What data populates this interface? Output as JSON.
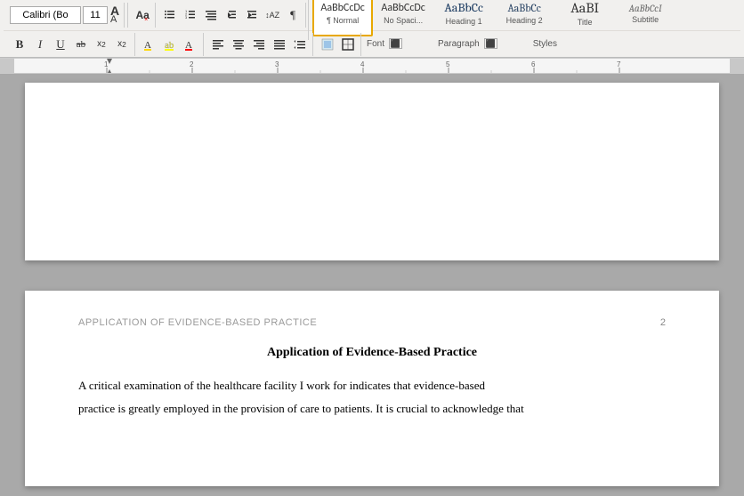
{
  "toolbar": {
    "row1": {
      "font_name": "Calibri (Bo",
      "font_size": "11",
      "increase_font": "A",
      "decrease_font": "A",
      "clear_format": "Aa",
      "bullets_label": "¶",
      "bold": "B",
      "italic": "I",
      "underline": "U",
      "strikethrough": "ab",
      "subscript": "x₂",
      "superscript": "x²",
      "highlight": "A",
      "color": "A"
    },
    "row2": {
      "align_left": "≡",
      "align_center": "≡",
      "align_right": "≡",
      "justify": "≡",
      "line_spacing": "≡",
      "shading": "▤",
      "borders": "▦"
    },
    "styles": [
      {
        "id": "normal",
        "preview": "AaBbCcDc",
        "label": "¶ Normal",
        "active": true
      },
      {
        "id": "no-spacing",
        "preview": "AaBbCcDc",
        "label": "No Spaci...",
        "active": false
      },
      {
        "id": "heading1",
        "preview": "AaBbCc",
        "label": "Heading 1",
        "active": false
      },
      {
        "id": "heading2",
        "preview": "AaBbCc",
        "label": "Heading 2",
        "active": false
      },
      {
        "id": "title",
        "preview": "AaBI",
        "label": "Title",
        "active": false
      },
      {
        "id": "subtitle",
        "preview": "AaBbCcI",
        "label": "Subtitle",
        "active": false
      }
    ],
    "labels": {
      "font": "Font",
      "paragraph": "Paragraph",
      "styles": "Styles"
    }
  },
  "document": {
    "page1_content": "",
    "page2": {
      "header": "APPLICATION OF EVIDENCE-BASED PRACTICE",
      "page_number": "2",
      "title": "Application of Evidence-Based Practice",
      "body_line1": "A critical examination of the healthcare facility I work for indicates that evidence-based",
      "body_line2": "practice is greatly employed in the provision of care to patients. It is crucial to acknowledge that"
    }
  },
  "ruler": {
    "marks": "| | | | | | | | |"
  }
}
